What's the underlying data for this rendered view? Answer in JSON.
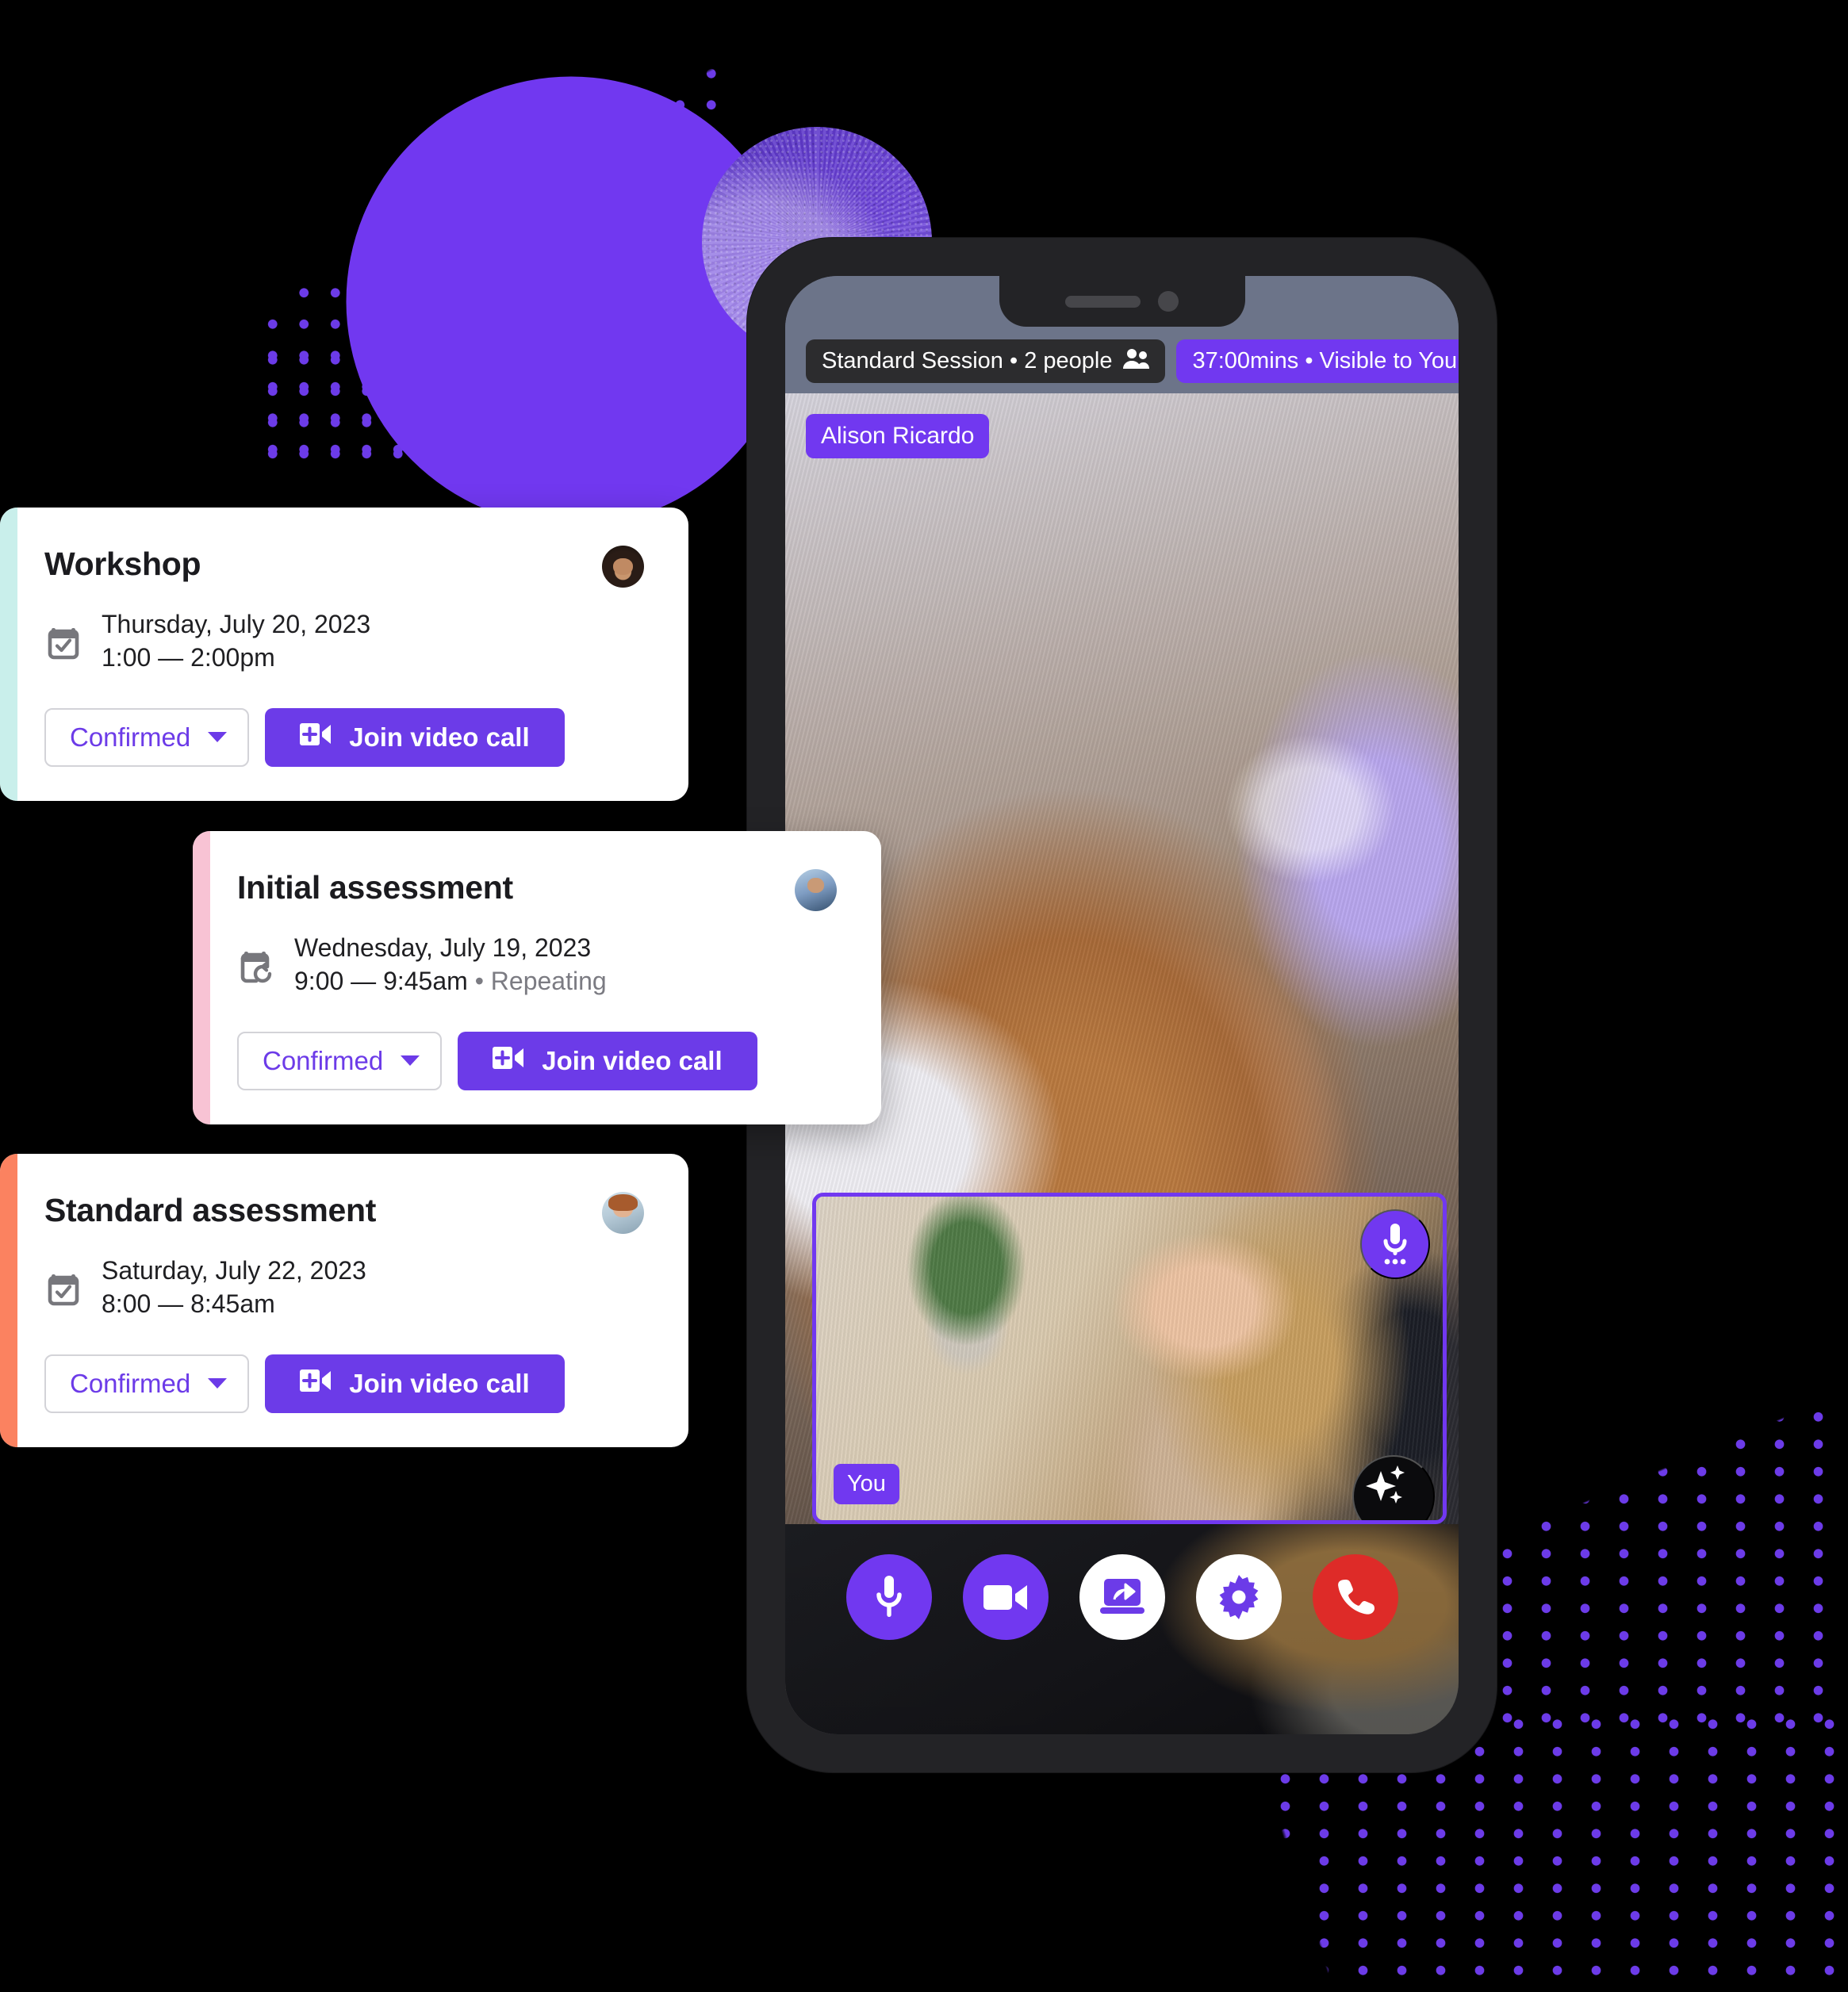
{
  "theme": {
    "primary": "#6C3BE8",
    "primary_bright": "#7138F0",
    "danger": "#DE2B28",
    "bg": "#000000",
    "phone_frame": "#232326",
    "card_accents": {
      "workshop": "#C9EFEB",
      "initial_assessment": "#F8C3D4",
      "standard_assessment": "#FB8260"
    }
  },
  "cards": [
    {
      "title": "Workshop",
      "date": "Thursday, July 20, 2023",
      "time": "1:00 — 2:00pm",
      "repeat": "",
      "calendar_icon": "calendar-check-icon",
      "status_label": "Confirmed",
      "join_label": "Join video call",
      "join_icon": "video-add-icon",
      "avatar": "avatar-bearded-man"
    },
    {
      "title": "Initial assessment",
      "date": "Wednesday, July 19, 2023",
      "time": "9:00 — 9:45am",
      "repeat": " • Repeating",
      "calendar_icon": "calendar-repeat-icon",
      "status_label": "Confirmed",
      "join_label": "Join video call",
      "join_icon": "video-add-icon",
      "avatar": "avatar-man-glasses"
    },
    {
      "title": "Standard assessment",
      "date": "Saturday, July 22, 2023",
      "time": "8:00 — 8:45am",
      "repeat": "",
      "calendar_icon": "calendar-check-icon",
      "status_label": "Confirmed",
      "join_label": "Join video call",
      "join_icon": "video-add-icon",
      "avatar": "avatar-red-haired-woman"
    }
  ],
  "phone": {
    "status_pills": [
      {
        "text": "Standard Session • 2 people",
        "icon": "people-icon",
        "style": "dark"
      },
      {
        "text": "37:00mins • Visible to You",
        "icon": "",
        "style": "purple"
      }
    ],
    "main_video": {
      "participant_name": "Alison Ricardo"
    },
    "self_view": {
      "label": "You",
      "mic_icon": "microphone-dots-icon",
      "effects_icon": "sparkles-icon"
    },
    "controls": [
      {
        "name": "microphone-button",
        "icon": "microphone-icon",
        "style": "purple"
      },
      {
        "name": "camera-button",
        "icon": "video-camera-icon",
        "style": "purple"
      },
      {
        "name": "share-screen-button",
        "icon": "screen-share-icon",
        "style": "white"
      },
      {
        "name": "settings-button",
        "icon": "gear-icon",
        "style": "white"
      },
      {
        "name": "end-call-button",
        "icon": "phone-hangup-icon",
        "style": "red"
      }
    ]
  }
}
